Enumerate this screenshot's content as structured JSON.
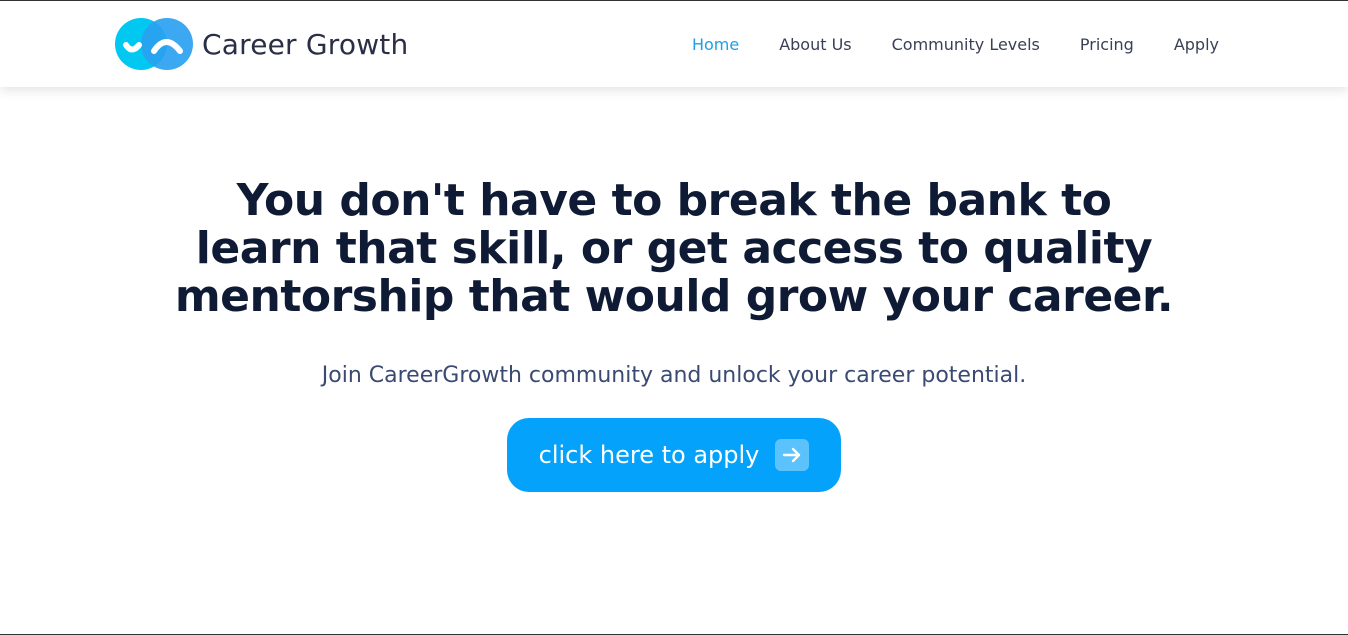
{
  "header": {
    "brand_name": "Career Growth",
    "logo_icon": "career-growth-logo-icon",
    "nav": [
      {
        "label": "Home",
        "active": true
      },
      {
        "label": "About Us",
        "active": false
      },
      {
        "label": "Community Levels",
        "active": false
      },
      {
        "label": "Pricing",
        "active": false
      },
      {
        "label": "Apply",
        "active": false
      }
    ]
  },
  "hero": {
    "headline": "You don't have to break the bank to learn that skill, or get access to quality mentorship that would grow your career.",
    "subline": "Join CareerGrowth community and unlock your career potential.",
    "cta_label": "click here to apply",
    "cta_icon": "arrow-right-icon"
  },
  "colors": {
    "accent": "#05a2fb",
    "nav_active": "#1ba0e8",
    "headline": "#0f1b35",
    "subline": "#3b4a73"
  }
}
